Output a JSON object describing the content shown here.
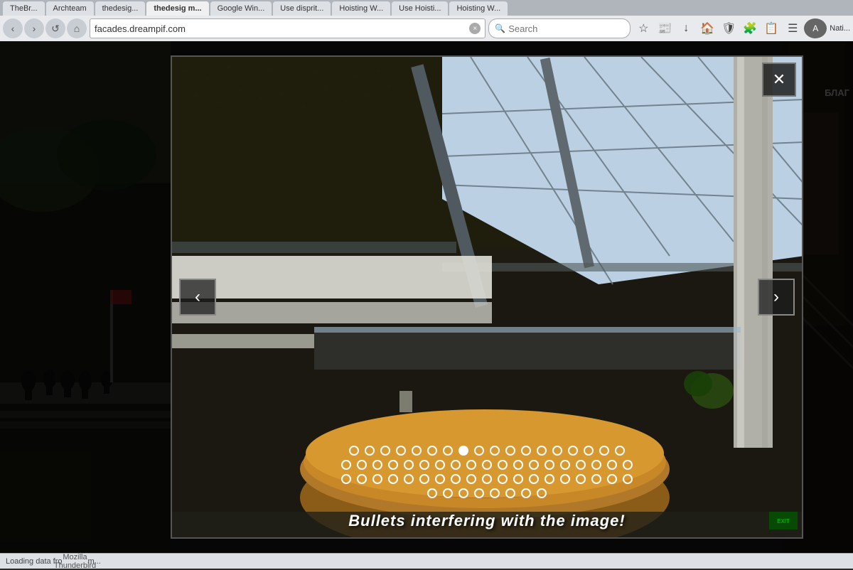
{
  "browser": {
    "address": "facades.dreampif.com",
    "close_tab_label": "×",
    "search_placeholder": "Search",
    "tabs": [
      {
        "label": "TheBr..."
      },
      {
        "label": "Archteam"
      },
      {
        "label": "thedesig..."
      },
      {
        "label": "thedesig m..."
      },
      {
        "label": "Google Win..."
      },
      {
        "label": "Use disprit..."
      },
      {
        "label": "Hoisting W..."
      },
      {
        "label": "Use Hoisti..."
      },
      {
        "label": "Hoisting W..."
      }
    ],
    "nav": {
      "back": "‹",
      "forward": "›",
      "refresh": "↺",
      "home": "⌂"
    }
  },
  "lightbox": {
    "close_btn_label": "✕",
    "prev_arrow": "‹",
    "next_arrow": "›",
    "caption": "Bullets interfering with the image!",
    "bullets": {
      "rows": [
        {
          "count": 18,
          "active_index": 7
        },
        {
          "count": 19,
          "active_index": -1
        },
        {
          "count": 19,
          "active_index": -1
        },
        {
          "count": 8,
          "active_index": -1
        }
      ]
    }
  },
  "cyrillic": "БЛАГ",
  "status": {
    "text": "Loading data fro",
    "extension1": "Mozilla Thunderbird",
    "extension2": "m..."
  }
}
